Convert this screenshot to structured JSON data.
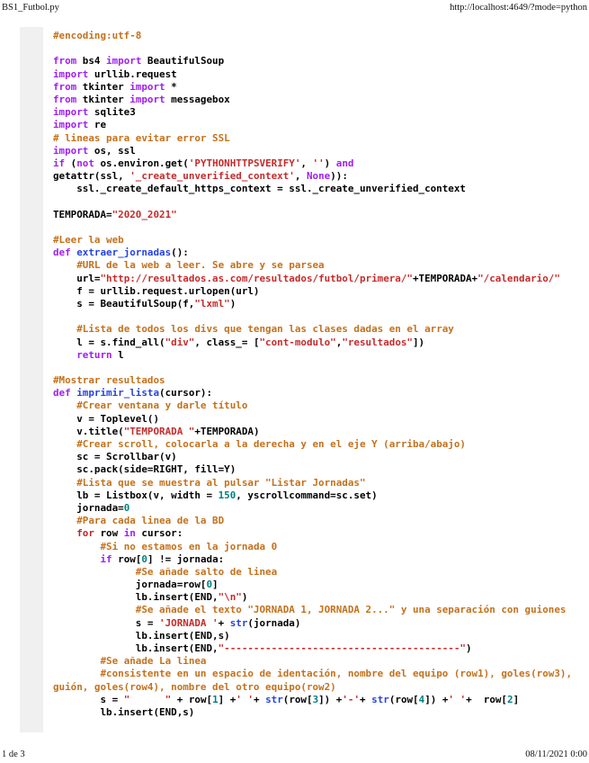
{
  "header": {
    "file_title": "BS1_Futbol.py",
    "url": "http://localhost:4649/?mode=python"
  },
  "footer": {
    "page_info": "1 de 3",
    "timestamp": "08/11/2021 0:00"
  },
  "palette": {
    "keyword": "#A020F0",
    "comment": "#C4711C",
    "string": "#C52B2B",
    "loop": "#C22626",
    "definition": "#2743DC",
    "number": "#008080",
    "plain": "#000000",
    "gutter": "#F0F0F0"
  },
  "code": {
    "language": "python",
    "lines": [
      [
        [
          "c",
          "#encoding:utf-8"
        ]
      ],
      [],
      [
        [
          "k",
          "from"
        ],
        [
          "t",
          " bs4 "
        ],
        [
          "k",
          "import"
        ],
        [
          "t",
          " BeautifulSoup"
        ]
      ],
      [
        [
          "k",
          "import"
        ],
        [
          "t",
          " urllib.request"
        ]
      ],
      [
        [
          "k",
          "from"
        ],
        [
          "t",
          " tkinter "
        ],
        [
          "k",
          "import"
        ],
        [
          "t",
          " *"
        ]
      ],
      [
        [
          "k",
          "from"
        ],
        [
          "t",
          " tkinter "
        ],
        [
          "k",
          "import"
        ],
        [
          "t",
          " messagebox"
        ]
      ],
      [
        [
          "k",
          "import"
        ],
        [
          "t",
          " sqlite3"
        ]
      ],
      [
        [
          "k",
          "import"
        ],
        [
          "t",
          " re"
        ]
      ],
      [
        [
          "c",
          "# lineas para evitar error SSL"
        ]
      ],
      [
        [
          "k",
          "import"
        ],
        [
          "t",
          " os, ssl"
        ]
      ],
      [
        [
          "k",
          "if"
        ],
        [
          "t",
          " ("
        ],
        [
          "k",
          "not"
        ],
        [
          "t",
          " os.environ.get("
        ],
        [
          "s",
          "'PYTHONHTTPSVERIFY'"
        ],
        [
          "t",
          ", "
        ],
        [
          "s",
          "''"
        ],
        [
          "t",
          ") "
        ],
        [
          "k",
          "and"
        ]
      ],
      [
        [
          "t",
          "getattr(ssl, "
        ],
        [
          "s",
          "'_create_unverified_context'"
        ],
        [
          "t",
          ", "
        ],
        [
          "k",
          "None"
        ],
        [
          "t",
          ")):"
        ]
      ],
      [
        [
          "t",
          "    ssl._create_default_https_context = ssl._create_unverified_context"
        ]
      ],
      [],
      [
        [
          "t",
          "TEMPORADA="
        ],
        [
          "s",
          "\"2020_2021\""
        ]
      ],
      [],
      [
        [
          "c",
          "#Leer la web"
        ]
      ],
      [
        [
          "k",
          "def"
        ],
        [
          "t",
          " "
        ],
        [
          "d",
          "extraer_jornadas"
        ],
        [
          "t",
          "():"
        ]
      ],
      [
        [
          "t",
          "    "
        ],
        [
          "c",
          "#URL de la web a leer. Se abre y se parsea"
        ]
      ],
      [
        [
          "t",
          "    url="
        ],
        [
          "s",
          "\"http://resultados.as.com/resultados/futbol/primera/\""
        ],
        [
          "t",
          "+TEMPORADA+"
        ],
        [
          "s",
          "\"/calendario/\""
        ]
      ],
      [
        [
          "t",
          "    f = urllib.request.urlopen(url)"
        ]
      ],
      [
        [
          "t",
          "    s = BeautifulSoup(f,"
        ],
        [
          "s",
          "\"lxml\""
        ],
        [
          "t",
          ")"
        ]
      ],
      [],
      [
        [
          "t",
          "    "
        ],
        [
          "c",
          "#Lista de todos los divs que tengan las clases dadas en el array"
        ]
      ],
      [
        [
          "t",
          "    l = s.find_all("
        ],
        [
          "s",
          "\"div\""
        ],
        [
          "t",
          ", class_= ["
        ],
        [
          "s",
          "\"cont-modulo\""
        ],
        [
          "t",
          ","
        ],
        [
          "s",
          "\"resultados\""
        ],
        [
          "t",
          "])"
        ]
      ],
      [
        [
          "t",
          "    "
        ],
        [
          "k",
          "return"
        ],
        [
          "t",
          " l"
        ]
      ],
      [],
      [
        [
          "c",
          "#Mostrar resultados"
        ]
      ],
      [
        [
          "k",
          "def"
        ],
        [
          "t",
          " "
        ],
        [
          "d",
          "imprimir_lista"
        ],
        [
          "t",
          "(cursor):"
        ]
      ],
      [
        [
          "t",
          "    "
        ],
        [
          "c",
          "#Crear ventana y darle título"
        ]
      ],
      [
        [
          "t",
          "    v = Toplevel()"
        ]
      ],
      [
        [
          "t",
          "    v.title("
        ],
        [
          "s",
          "\"TEMPORADA \""
        ],
        [
          "t",
          "+TEMPORADA)"
        ]
      ],
      [
        [
          "t",
          "    "
        ],
        [
          "c",
          "#Crear scroll, colocarla a la derecha y en el eje Y (arriba/abajo)"
        ]
      ],
      [
        [
          "t",
          "    sc = Scrollbar(v)"
        ]
      ],
      [
        [
          "t",
          "    sc.pack(side=RIGHT, fill=Y)"
        ]
      ],
      [
        [
          "t",
          "    "
        ],
        [
          "c",
          "#Lista que se muestra al pulsar \"Listar Jornadas\""
        ]
      ],
      [
        [
          "t",
          "    lb = Listbox(v, width = "
        ],
        [
          "n",
          "150"
        ],
        [
          "t",
          ", yscrollcommand=sc.set)"
        ]
      ],
      [
        [
          "t",
          "    jornada="
        ],
        [
          "n",
          "0"
        ]
      ],
      [
        [
          "t",
          "    "
        ],
        [
          "c",
          "#Para cada linea de la BD"
        ]
      ],
      [
        [
          "t",
          "    "
        ],
        [
          "r",
          "for"
        ],
        [
          "t",
          " row "
        ],
        [
          "k",
          "in"
        ],
        [
          "t",
          " cursor:"
        ]
      ],
      [
        [
          "t",
          "        "
        ],
        [
          "c",
          "#Si no estamos en la jornada 0"
        ]
      ],
      [
        [
          "t",
          "        "
        ],
        [
          "k",
          "if"
        ],
        [
          "t",
          " row["
        ],
        [
          "n",
          "0"
        ],
        [
          "t",
          "] != jornada:"
        ]
      ],
      [
        [
          "t",
          "              "
        ],
        [
          "c",
          "#Se añade salto de linea"
        ]
      ],
      [
        [
          "t",
          "              jornada=row["
        ],
        [
          "n",
          "0"
        ],
        [
          "t",
          "]"
        ]
      ],
      [
        [
          "t",
          "              lb.insert(END,"
        ],
        [
          "s",
          "\"\\n\""
        ],
        [
          "t",
          ")"
        ]
      ],
      [
        [
          "t",
          "              "
        ],
        [
          "c",
          "#Se añade el texto \"JORNADA 1, JORNADA 2...\" y una separación con guiones"
        ]
      ],
      [
        [
          "t",
          "              s = "
        ],
        [
          "s",
          "'JORNADA '"
        ],
        [
          "t",
          "+ "
        ],
        [
          "d",
          "str"
        ],
        [
          "t",
          "(jornada)"
        ]
      ],
      [
        [
          "t",
          "              lb.insert(END,s)"
        ]
      ],
      [
        [
          "t",
          "              lb.insert(END,"
        ],
        [
          "s",
          "\"----------------------------------------\""
        ],
        [
          "t",
          ")"
        ]
      ],
      [
        [
          "t",
          "        "
        ],
        [
          "c",
          "#Se añade La linea"
        ]
      ],
      [
        [
          "t",
          "        "
        ],
        [
          "c",
          "#consistente en un espacio de identación, nombre del equipo (row1), goles(row3),"
        ]
      ],
      [
        [
          "c",
          "guión, goles(row4), nombre del otro equipo(row2)"
        ]
      ],
      [
        [
          "t",
          "        s = "
        ],
        [
          "s",
          "\"      \""
        ],
        [
          "t",
          " + row["
        ],
        [
          "n",
          "1"
        ],
        [
          "t",
          "] +"
        ],
        [
          "s",
          "' '"
        ],
        [
          "t",
          "+ "
        ],
        [
          "d",
          "str"
        ],
        [
          "t",
          "(row["
        ],
        [
          "n",
          "3"
        ],
        [
          "t",
          "]) +"
        ],
        [
          "s",
          "'-'"
        ],
        [
          "t",
          "+ "
        ],
        [
          "d",
          "str"
        ],
        [
          "t",
          "(row["
        ],
        [
          "n",
          "4"
        ],
        [
          "t",
          "]) +"
        ],
        [
          "s",
          "' '"
        ],
        [
          "t",
          "+  row["
        ],
        [
          "n",
          "2"
        ],
        [
          "t",
          "]"
        ]
      ],
      [
        [
          "t",
          "        lb.insert(END,s)"
        ]
      ]
    ]
  }
}
